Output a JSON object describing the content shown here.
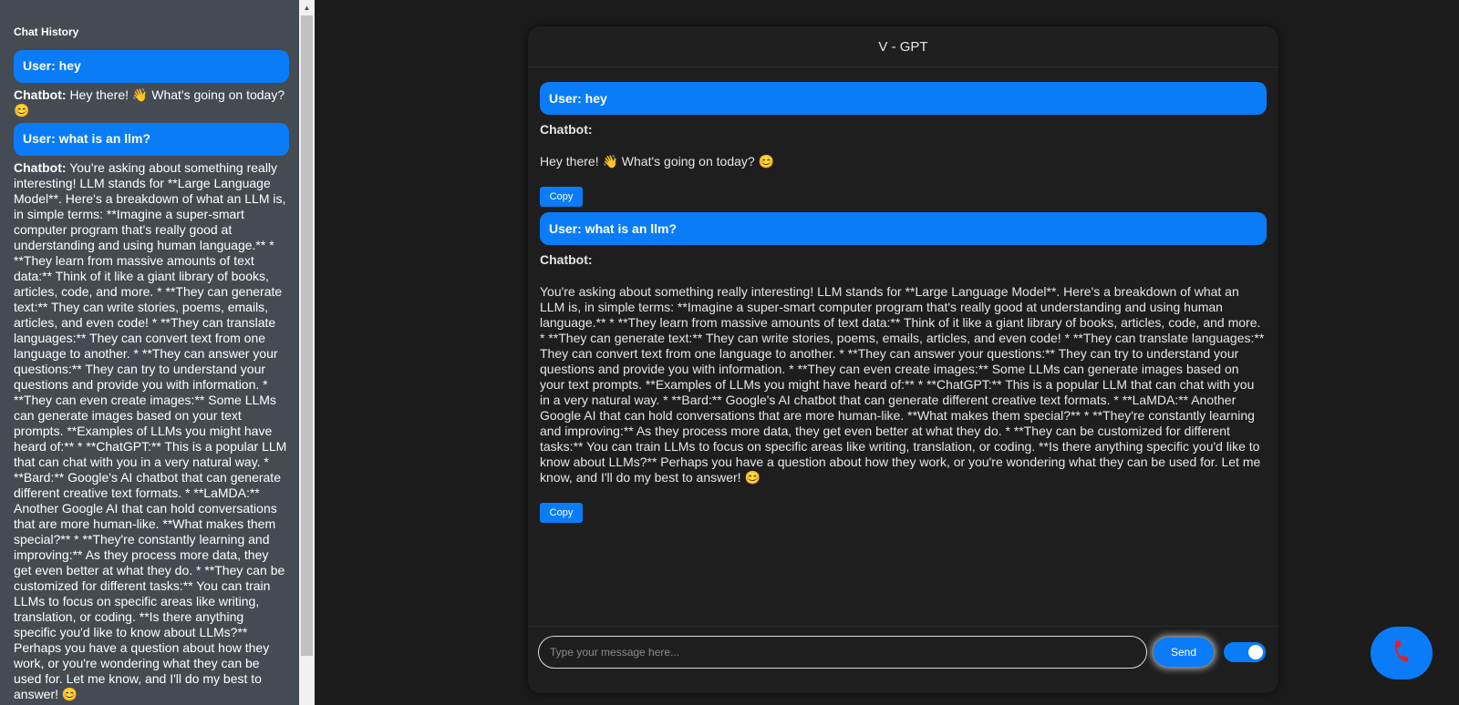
{
  "sidebar": {
    "title": "Chat History",
    "items": [
      {
        "type": "user",
        "label": "User: hey"
      },
      {
        "type": "bot",
        "label": "Chatbot:",
        "text": "Hey there!  👋  What's going on today? 😊"
      },
      {
        "type": "user",
        "label": "User: what is an llm?"
      },
      {
        "type": "bot",
        "label": "Chatbot:",
        "text": "You're asking about something really interesting! LLM stands for **Large Language Model**. Here's a breakdown of what an LLM is, in simple terms: **Imagine a super-smart computer program that's really good at understanding and using human language.** * **They learn from massive amounts of text data:** Think of it like a giant library of books, articles, code, and more. * **They can generate text:** They can write stories, poems, emails, articles, and even code! * **They can translate languages:** They can convert text from one language to another. * **They can answer your questions:** They can try to understand your questions and provide you with information. * **They can even create images:** Some LLMs can generate images based on your text prompts. **Examples of LLMs you might have heard of:** * **ChatGPT:** This is a popular LLM that can chat with you in a very natural way. * **Bard:** Google's AI chatbot that can generate different creative text formats. * **LaMDA:** Another Google AI that can hold conversations that are more human-like. **What makes them special?** * **They're constantly learning and improving:** As they process more data, they get even better at what they do. * **They can be customized for different tasks:** You can train LLMs to focus on specific areas like writing, translation, or coding. **Is there anything specific you'd like to know about LLMs?** Perhaps you have a question about how they work, or you're wondering what they can be used for. Let me know, and I'll do my best to answer! 😊"
      }
    ]
  },
  "chat": {
    "title": "V - GPT",
    "messages": [
      {
        "user": "User: hey",
        "bot_label": "Chatbot:",
        "bot_text": "Hey there!  👋  What's going on today? 😊",
        "copy_label": "Copy"
      },
      {
        "user": "User: what is an llm?",
        "bot_label": "Chatbot:",
        "bot_text": "You're asking about something really interesting! LLM stands for **Large Language Model**. Here's a breakdown of what an LLM is, in simple terms: **Imagine a super-smart computer program that's really good at understanding and using human language.** * **They learn from massive amounts of text data:** Think of it like a giant library of books, articles, code, and more. * **They can generate text:** They can write stories, poems, emails, articles, and even code! * **They can translate languages:** They can convert text from one language to another. * **They can answer your questions:** They can try to understand your questions and provide you with information. * **They can even create images:** Some LLMs can generate images based on your text prompts. **Examples of LLMs you might have heard of:** * **ChatGPT:** This is a popular LLM that can chat with you in a very natural way. * **Bard:** Google's AI chatbot that can generate different creative text formats. * **LaMDA:** Another Google AI that can hold conversations that are more human-like. **What makes them special?** * **They're constantly learning and improving:** As they process more data, they get even better at what they do. * **They can be customized for different tasks:** You can train LLMs to focus on specific areas like writing, translation, or coding. **Is there anything specific you'd like to know about LLMs?** Perhaps you have a question about how they work, or you're wondering what they can be used for. Let me know, and I'll do my best to answer! 😊",
        "copy_label": "Copy"
      }
    ]
  },
  "input": {
    "placeholder": "Type your message here...",
    "value": "",
    "send_label": "Send",
    "toggle_on": true
  },
  "call_button": {
    "icon": "phone-icon"
  },
  "colors": {
    "accent": "#0a7cf8",
    "sidebar_bg": "#444b53",
    "page_bg": "#1b1b1b",
    "panel_bg": "#1e1e1e"
  }
}
